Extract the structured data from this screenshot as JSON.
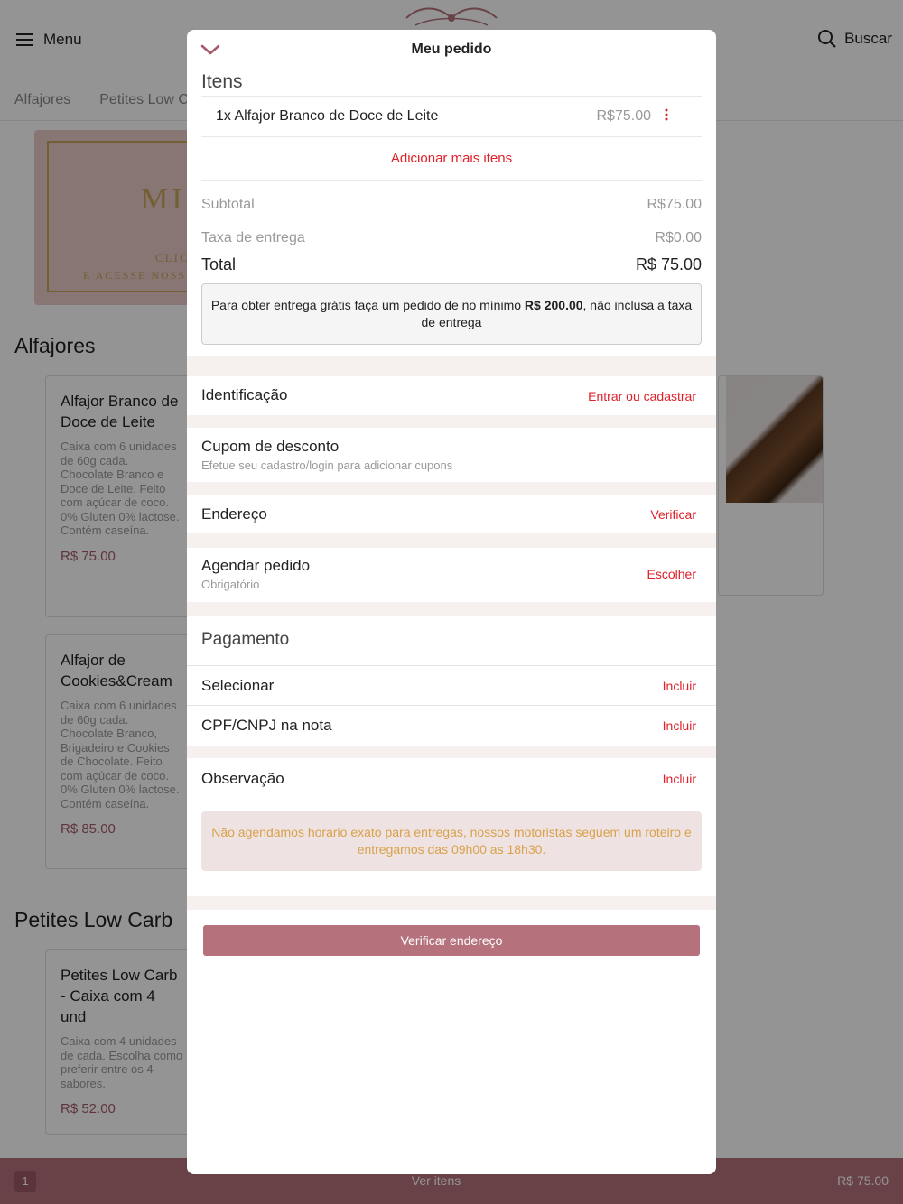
{
  "background": {
    "menu_label": "Menu",
    "search_label": "Buscar",
    "categories": [
      "Alfajores",
      "Petites Low Ca"
    ],
    "banner": {
      "big": "MI",
      "small1": "CLIC",
      "small2": "E ACESSE NOSS"
    },
    "sections": [
      {
        "title": "Alfajores"
      },
      {
        "title": "Petites Low Carb"
      }
    ],
    "products": [
      {
        "name": "Alfajor Branco de Doce de Leite",
        "desc": "Caixa com 6 unidades de 60g cada. Chocolate Branco e Doce de Leite. Feito com açúcar de coco. 0% Gluten 0% lactose. Contém caseína.",
        "price": "R$ 75.00"
      },
      {
        "name": "Alfajor de Cookies&Cream",
        "desc": "Caixa com 6 unidades de 60g cada. Chocolate Branco, Brigadeiro e Cookies de Chocolate. Feito com açúcar de coco. 0% Gluten 0% lactose. Contém caseína.",
        "price": "R$ 85.00"
      },
      {
        "name": "Petites Low Carb - Caixa com 4 und",
        "desc": "Caixa com 4 unidades de cada. Escolha como preferir entre os 4 sabores.",
        "price": "R$ 52.00"
      }
    ],
    "bottom_bar": {
      "count": "1",
      "label": "Ver itens",
      "total": "R$ 75.00",
      "color": "#b5727c"
    }
  },
  "modal": {
    "title": "Meu pedido",
    "items_heading": "Itens",
    "items": [
      {
        "name": "1x Alfajor Branco de Doce de Leite",
        "price": "R$75.00"
      }
    ],
    "add_more": "Adicionar mais itens",
    "subtotal_label": "Subtotal",
    "subtotal_value": "R$75.00",
    "delivery_label": "Taxa de entrega",
    "delivery_value": "R$0.00",
    "total_label": "Total",
    "total_value": "R$ 75.00",
    "promo_before": "Para obter entrega grátis faça um pedido de no mínimo ",
    "promo_amount": "R$ 200.00",
    "promo_after": ", não inclusa a taxa de entrega",
    "identification_label": "Identificação",
    "identification_action": "Entrar ou cadastrar",
    "coupon_label": "Cupom de desconto",
    "coupon_sub": "Efetue seu cadastro/login para adicionar cupons",
    "address_label": "Endereço",
    "address_action": "Verificar",
    "schedule_label": "Agendar pedido",
    "schedule_sub": "Obrigatório",
    "schedule_action": "Escolher",
    "payment_heading": "Pagamento",
    "payment_select_label": "Selecionar",
    "payment_select_action": "Incluir",
    "cpf_label": "CPF/CNPJ na nota",
    "cpf_action": "Incluir",
    "observation_label": "Observação",
    "observation_action": "Incluir",
    "delivery_note": "Não agendamos horario exato para entregas, nossos motoristas seguem um roteiro e entregamos das 09h00 as 18h30.",
    "verify_button": "Verificar endereço",
    "accent_color": "#e0202a",
    "button_color": "#b5727c"
  }
}
